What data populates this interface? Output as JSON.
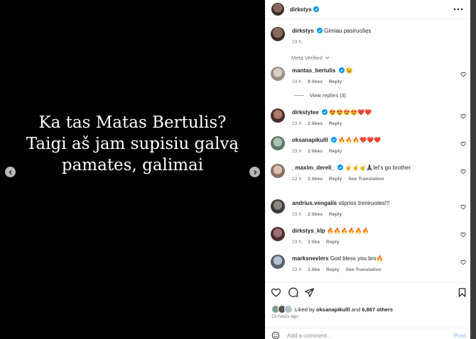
{
  "post": {
    "caption_lines": [
      "Ka tas Matas Bertulis?",
      "Taigi aš jam supisiu galvą",
      "pamates, galimai"
    ],
    "author": "dirkstys"
  },
  "caption": {
    "username": "dirkstys",
    "text": "Gimiau pasiruošęs",
    "time": "23 h",
    "meta_verified": "Meta Verified"
  },
  "comments": [
    {
      "username": "mantas_bertulis",
      "verified": true,
      "text": "😉",
      "time": "23 h",
      "likes": "9 likes",
      "reply": "Reply",
      "translate": "",
      "avatar_color": "#c9c1b8"
    },
    {
      "username": "dirkstytee",
      "verified": true,
      "text": "😍😍😍😍❤️❤️",
      "time": "23 h",
      "likes": "2 likes",
      "reply": "Reply",
      "translate": "",
      "avatar_color": "#8a5a4a"
    },
    {
      "username": "oksanapikulll",
      "verified": true,
      "text": "🔥🔥🔥❤️❤️❤️",
      "time": "23 h",
      "likes": "2 likes",
      "reply": "Reply",
      "translate": "",
      "avatar_color": "#7e9c8a"
    },
    {
      "username": "_maxim_dereli_",
      "verified": true,
      "text": "☝️☝️☝️🙏🏿let's go brother",
      "time": "22 h",
      "likes": "2 likes",
      "reply": "Reply",
      "translate": "See Translation",
      "avatar_color": "#b89a8c"
    },
    {
      "username": "andrius.vengalis",
      "verified": false,
      "text": "stiprios treniruotes!!!",
      "time": "23 h",
      "likes": "2 likes",
      "reply": "Reply",
      "translate": "",
      "avatar_color": "#5a5550"
    },
    {
      "username": "dirkstys_klp",
      "verified": false,
      "text": "🔥🔥🔥🔥🔥🔥",
      "time": "23 h",
      "likes": "1 like",
      "reply": "Reply",
      "translate": "",
      "avatar_color": "#6b4b4b"
    },
    {
      "username": "marksnevlers",
      "verified": false,
      "text": "God bless you bro🔥",
      "time": "23 h",
      "likes": "1 like",
      "reply": "Reply",
      "translate": "See Translation",
      "avatar_color": "#7c8a96"
    }
  ],
  "view_replies": "View replies (3)",
  "liked_by": {
    "prefix": "Liked by",
    "user": "oksanapikulll",
    "joiner": "and",
    "count": "6,867 others"
  },
  "time_ago": "23 hours ago",
  "add_comment": {
    "placeholder": "Add a comment…",
    "post": "Post"
  },
  "colors": {
    "verified": "#0095f6",
    "heart_red": "#ed4956"
  }
}
